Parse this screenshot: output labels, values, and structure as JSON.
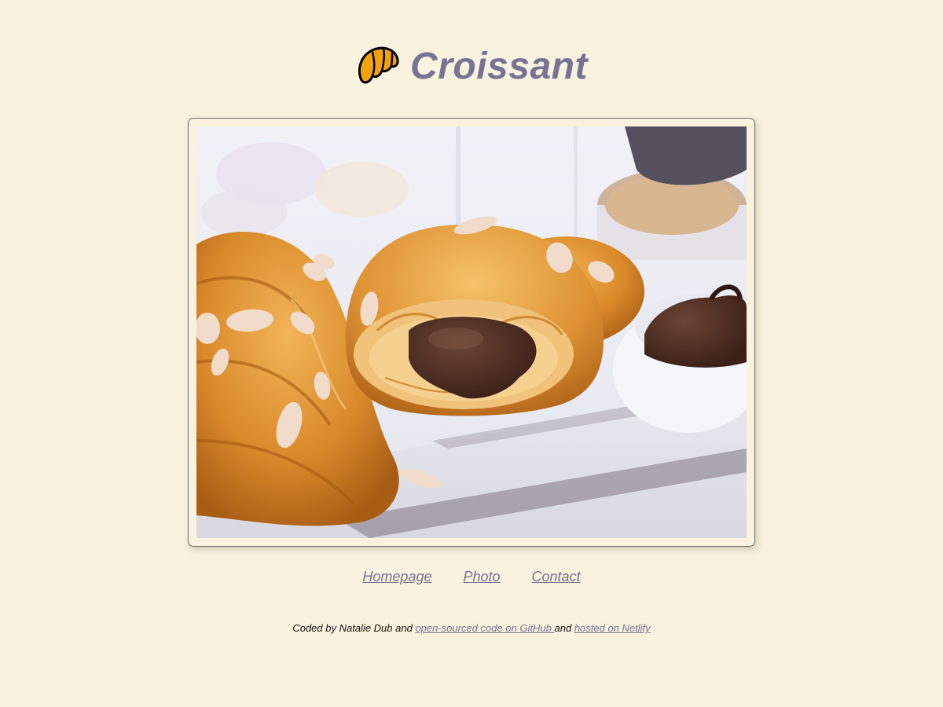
{
  "header": {
    "logo_icon": "croissant-icon",
    "title": "Croissant"
  },
  "photo": {
    "alt": "Croissants with chocolate filling",
    "frame_color": "#707070"
  },
  "nav": {
    "items": [
      {
        "label": "Homepage"
      },
      {
        "label": "Photo"
      },
      {
        "label": "Contact"
      }
    ]
  },
  "footer": {
    "prefix": "Coded by Natalie Dub and ",
    "github_link": "open-sourced code on GitHub ",
    "middle": "and ",
    "netlify_link": "hosted on Netlify"
  },
  "colors": {
    "background": "#f8f2de",
    "accent": "#767394",
    "logo_fill": "#f0a30a"
  }
}
